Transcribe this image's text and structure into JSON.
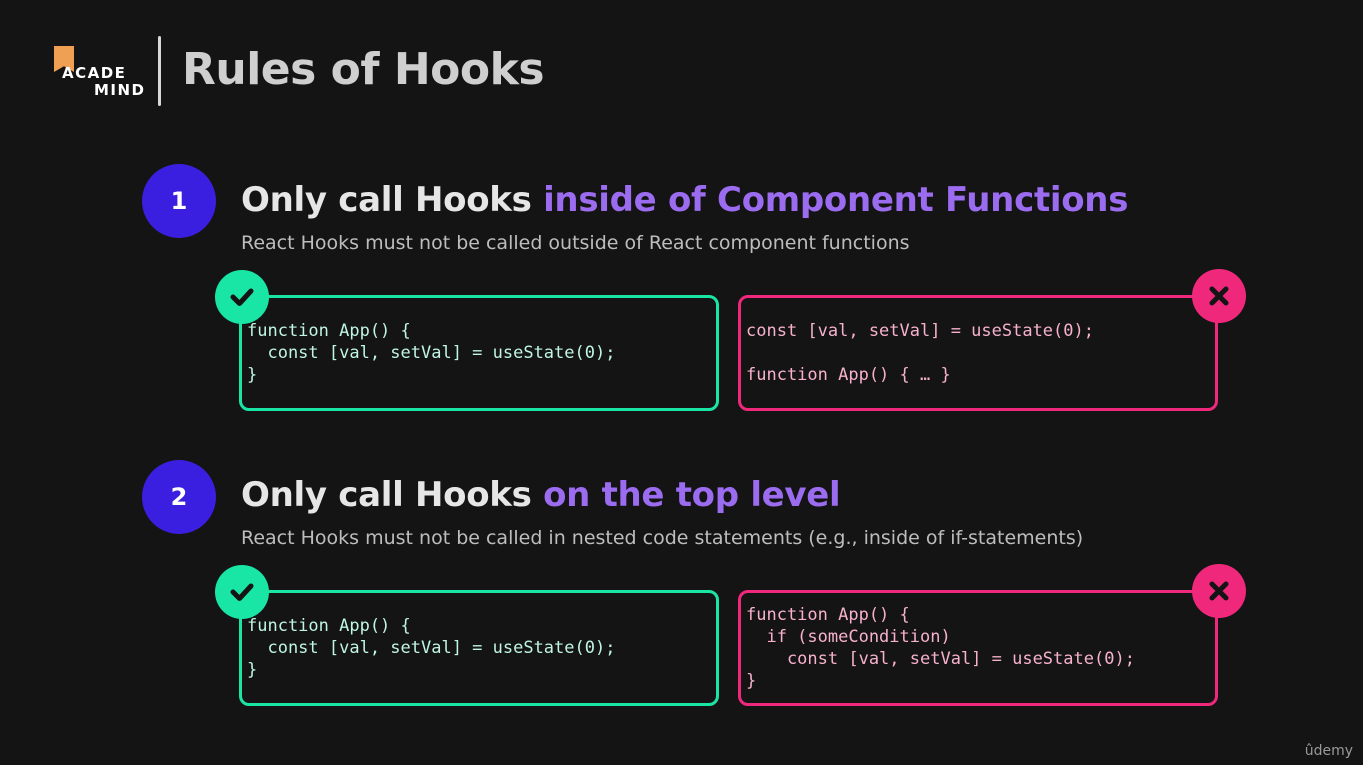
{
  "logo": {
    "line1": "ACADE",
    "line2": "MIND"
  },
  "title": "Rules of Hooks",
  "rules": [
    {
      "number": "1",
      "heading_plain": "Only call Hooks ",
      "heading_highlight": "inside of Component Functions",
      "subtitle": "React Hooks must not be called outside of React component functions",
      "good_code": "function App() {\n  const [val, setVal] = useState(0);\n}",
      "bad_code": "const [val, setVal] = useState(0);\n\nfunction App() { … }"
    },
    {
      "number": "2",
      "heading_plain": "Only call Hooks ",
      "heading_highlight": "on the top level",
      "subtitle": "React Hooks must not be called in nested code statements (e.g., inside of if-statements)",
      "good_code": "function App() {\n  const [val, setVal] = useState(0);\n}",
      "bad_code": "function App() {\n  if (someCondition)\n    const [val, setVal] = useState(0);\n}"
    }
  ],
  "icons": {
    "good": "checkmark-icon",
    "bad": "x-icon"
  },
  "colors": {
    "accent_purple": "#9b6cf0",
    "number_circle": "#3b1fe0",
    "good": "#19e6a4",
    "bad": "#f0287c"
  },
  "watermark": "ûdemy"
}
